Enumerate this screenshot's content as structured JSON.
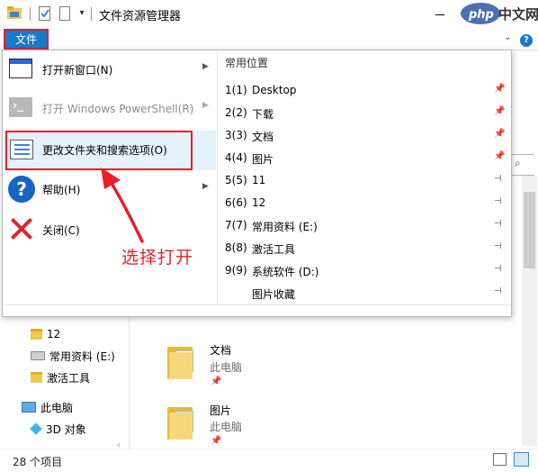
{
  "window": {
    "title": "文件资源管理器",
    "watermark": "php中文网"
  },
  "ribbon": {
    "file_tab": "文件"
  },
  "file_menu": {
    "items": [
      {
        "label": "打开新窗口(N)",
        "icon": "new-window-icon",
        "submenu": true,
        "enabled": true
      },
      {
        "label": "打开 Windows PowerShell(R)",
        "icon": "powershell-icon",
        "submenu": true,
        "enabled": false
      },
      {
        "label": "更改文件夹和搜索选项(O)",
        "icon": "folder-options-icon",
        "submenu": false,
        "enabled": true,
        "highlighted": true
      },
      {
        "label": "帮助(H)",
        "icon": "help-icon",
        "submenu": true,
        "enabled": true
      },
      {
        "label": "关闭(C)",
        "icon": "close-icon",
        "submenu": false,
        "enabled": true
      }
    ],
    "common_places": {
      "header": "常用位置",
      "items": [
        {
          "num": "1(1)",
          "label": "Desktop",
          "pin": "pinned"
        },
        {
          "num": "2(2)",
          "label": "下载",
          "pin": "pinned"
        },
        {
          "num": "3(3)",
          "label": "文档",
          "pin": "pinned"
        },
        {
          "num": "4(4)",
          "label": "图片",
          "pin": "pinned"
        },
        {
          "num": "5(5)",
          "label": "11",
          "pin": "unpinned"
        },
        {
          "num": "6(6)",
          "label": "12",
          "pin": "unpinned"
        },
        {
          "num": "7(7)",
          "label": "常用资料 (E:)",
          "pin": "unpinned"
        },
        {
          "num": "8(8)",
          "label": "激活工具",
          "pin": "unpinned"
        },
        {
          "num": "9(9)",
          "label": "系统软件 (D:)",
          "pin": "unpinned"
        },
        {
          "num": "",
          "label": "图片收藏",
          "pin": "unpinned"
        }
      ]
    }
  },
  "annotation": {
    "text": "选择打开",
    "color": "#e8202a"
  },
  "nav_pane": {
    "items": [
      {
        "label": "12",
        "icon": "folder-icon"
      },
      {
        "label": "常用资料 (E:)",
        "icon": "drive-icon"
      },
      {
        "label": "激活工具",
        "icon": "folder-icon"
      },
      {
        "label": "此电脑",
        "icon": "pc-icon"
      },
      {
        "label": "3D 对象",
        "icon": "3d-objects-icon"
      }
    ]
  },
  "content": {
    "items": [
      {
        "title": "文档",
        "subtitle": "此电脑"
      },
      {
        "title": "图片",
        "subtitle": "此电脑"
      }
    ]
  },
  "status_bar": {
    "count": "28 个项目"
  },
  "colors": {
    "accent": "#1979ca",
    "highlight_border": "#e8202a",
    "selected_bg": "#e5f1fb"
  }
}
